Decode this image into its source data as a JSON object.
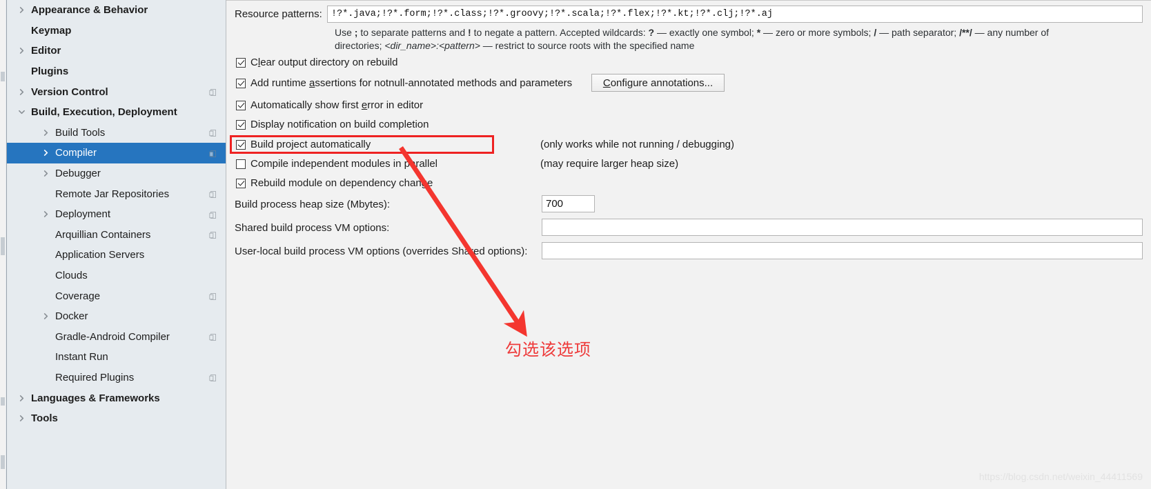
{
  "sidebar": {
    "items": [
      {
        "label": "Appearance & Behavior",
        "arrow": "collapsed",
        "bold": true,
        "indent": 0,
        "badge": false,
        "selected": false
      },
      {
        "label": "Keymap",
        "arrow": "none",
        "bold": true,
        "indent": 0,
        "badge": false,
        "selected": false
      },
      {
        "label": "Editor",
        "arrow": "collapsed",
        "bold": true,
        "indent": 0,
        "badge": false,
        "selected": false
      },
      {
        "label": "Plugins",
        "arrow": "none",
        "bold": true,
        "indent": 0,
        "badge": false,
        "selected": false
      },
      {
        "label": "Version Control",
        "arrow": "collapsed",
        "bold": true,
        "indent": 0,
        "badge": true,
        "selected": false
      },
      {
        "label": "Build, Execution, Deployment",
        "arrow": "expanded",
        "bold": true,
        "indent": 0,
        "badge": false,
        "selected": false
      },
      {
        "label": "Build Tools",
        "arrow": "collapsed",
        "bold": false,
        "indent": 1,
        "badge": true,
        "selected": false
      },
      {
        "label": "Compiler",
        "arrow": "collapsed",
        "bold": false,
        "indent": 1,
        "badge": true,
        "selected": true
      },
      {
        "label": "Debugger",
        "arrow": "collapsed",
        "bold": false,
        "indent": 1,
        "badge": false,
        "selected": false
      },
      {
        "label": "Remote Jar Repositories",
        "arrow": "none",
        "bold": false,
        "indent": 1,
        "badge": true,
        "selected": false
      },
      {
        "label": "Deployment",
        "arrow": "collapsed",
        "bold": false,
        "indent": 1,
        "badge": true,
        "selected": false
      },
      {
        "label": "Arquillian Containers",
        "arrow": "none",
        "bold": false,
        "indent": 1,
        "badge": true,
        "selected": false
      },
      {
        "label": "Application Servers",
        "arrow": "none",
        "bold": false,
        "indent": 1,
        "badge": false,
        "selected": false
      },
      {
        "label": "Clouds",
        "arrow": "none",
        "bold": false,
        "indent": 1,
        "badge": false,
        "selected": false
      },
      {
        "label": "Coverage",
        "arrow": "none",
        "bold": false,
        "indent": 1,
        "badge": true,
        "selected": false
      },
      {
        "label": "Docker",
        "arrow": "collapsed",
        "bold": false,
        "indent": 1,
        "badge": false,
        "selected": false
      },
      {
        "label": "Gradle-Android Compiler",
        "arrow": "none",
        "bold": false,
        "indent": 1,
        "badge": true,
        "selected": false
      },
      {
        "label": "Instant Run",
        "arrow": "none",
        "bold": false,
        "indent": 1,
        "badge": false,
        "selected": false
      },
      {
        "label": "Required Plugins",
        "arrow": "none",
        "bold": false,
        "indent": 1,
        "badge": true,
        "selected": false
      },
      {
        "label": "Languages & Frameworks",
        "arrow": "collapsed",
        "bold": true,
        "indent": 0,
        "badge": false,
        "selected": false
      },
      {
        "label": "Tools",
        "arrow": "collapsed",
        "bold": true,
        "indent": 0,
        "badge": false,
        "selected": false
      }
    ]
  },
  "main": {
    "resource_patterns": {
      "label": "Resource patterns:",
      "value": "!?*.java;!?*.form;!?*.class;!?*.groovy;!?*.scala;!?*.flex;!?*.kt;!?*.clj;!?*.aj"
    },
    "hint_line1_a": "Use ",
    "hint_line1_semicolon": ";",
    "hint_line1_b": " to separate patterns and ",
    "hint_line1_bang": "!",
    "hint_line1_c": " to negate a pattern. Accepted wildcards: ",
    "hint_line1_q": "?",
    "hint_line1_d": " — exactly one symbol; ",
    "hint_line1_star": "*",
    "hint_line1_e": " — zero or more symbols; ",
    "hint_line1_slash": "/",
    "hint_line1_f": " — path separator; ",
    "hint_line1_globstar": "/**/",
    "hint_line1_g": " — any number of",
    "hint_line2_a": "directories; ",
    "hint_line2_dirname": "<dir_name>:<pattern>",
    "hint_line2_b": " — restrict to source roots with the specified name",
    "checkboxes": [
      {
        "label_pre": "C",
        "label_accel": "l",
        "label_post": "ear output directory on rebuild",
        "checked": true
      },
      {
        "label_pre": "Add runtime ",
        "label_accel": "a",
        "label_post": "ssertions for notnull-annotated methods and parameters",
        "checked": true
      },
      {
        "label_pre": "Automatically show first ",
        "label_accel": "e",
        "label_post": "rror in editor",
        "checked": true
      },
      {
        "label_pre": "Display notification on build completion",
        "label_accel": "",
        "label_post": "",
        "checked": true
      },
      {
        "label_pre": "Build project automatically",
        "label_accel": "",
        "label_post": "",
        "checked": true
      },
      {
        "label_pre": "Compile independent modules in parallel",
        "label_accel": "",
        "label_post": "",
        "checked": false
      },
      {
        "label_pre": "Rebuild module on dependency change",
        "label_accel": "",
        "label_post": "",
        "checked": true
      }
    ],
    "configure_button": {
      "accel": "C",
      "rest": "onfigure annotations..."
    },
    "note_build_auto": "(only works while not running / debugging)",
    "note_parallel": "(may require larger heap size)",
    "heap_size": {
      "label": "Build process heap size (Mbytes):",
      "value": "700"
    },
    "shared_vm": {
      "label": "Shared build process VM options:",
      "value": ""
    },
    "user_local_vm": {
      "label": "User-local build process VM options (overrides Shared options):",
      "value": ""
    }
  },
  "annotation": {
    "text": "勾选该选项",
    "color": "#ee3b3b",
    "highlight_color": "#ee2222"
  },
  "watermark": "https://blog.csdn.net/weixin_44411569"
}
